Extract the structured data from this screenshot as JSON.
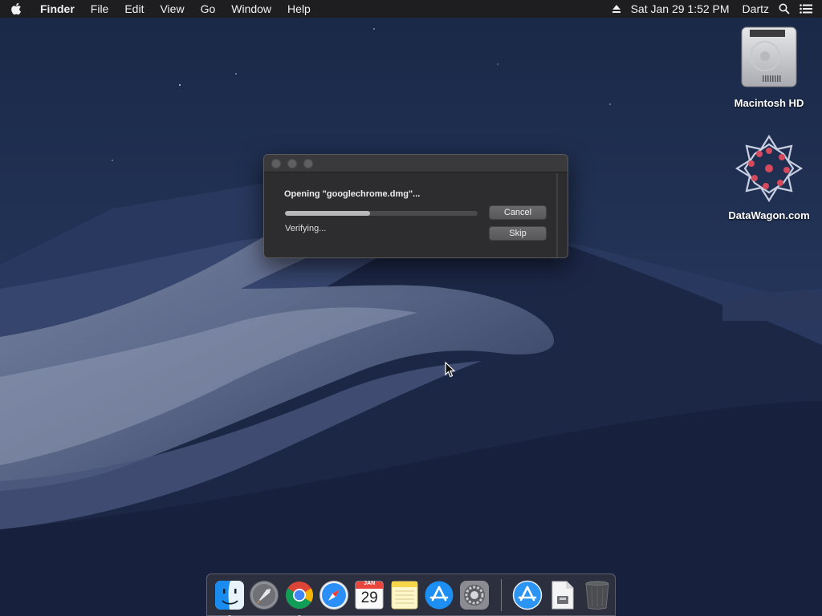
{
  "menubar": {
    "app_name": "Finder",
    "menus": [
      "File",
      "Edit",
      "View",
      "Go",
      "Window",
      "Help"
    ],
    "icons": [
      "apple-icon",
      "eject-icon",
      "spotlight-icon",
      "notification-center-icon"
    ],
    "clock": "Sat Jan 29  1:52 PM",
    "user": "Dartz"
  },
  "desktop": {
    "icons": [
      {
        "label": "Macintosh HD",
        "icon": "hard-drive-icon"
      },
      {
        "label": "DataWagon.com",
        "icon": "mounted-volume-icon"
      }
    ]
  },
  "dialog": {
    "title": "Opening \"googlechrome.dmg\"...",
    "status": "Verifying...",
    "progress": 0.44,
    "cancel_label": "Cancel",
    "skip_label": "Skip"
  },
  "dock": {
    "items": [
      {
        "name": "Finder",
        "icon": "finder-icon",
        "running": true
      },
      {
        "name": "Launchpad",
        "icon": "launchpad-icon",
        "running": false
      },
      {
        "name": "Google Chrome",
        "icon": "chrome-icon",
        "running": true
      },
      {
        "name": "Safari",
        "icon": "safari-icon",
        "running": false
      },
      {
        "name": "Calendar",
        "icon": "calendar-icon",
        "running": false,
        "month": "JAN",
        "day": "29"
      },
      {
        "name": "Notes",
        "icon": "notes-icon",
        "running": false
      },
      {
        "name": "App Store",
        "icon": "app-store-icon",
        "running": false
      },
      {
        "name": "System Preferences",
        "icon": "system-preferences-icon",
        "running": false
      },
      {
        "name": "Applications",
        "icon": "applications-folder-icon",
        "running": false
      },
      {
        "name": "Downloads",
        "icon": "downloads-icon",
        "running": false
      },
      {
        "name": "Trash",
        "icon": "trash-icon",
        "running": false
      }
    ]
  },
  "colors": {
    "menubar_bg": "#1e1e20",
    "dialog_bg": "#2d2d2f",
    "wallpaper_sky": "#1b2541",
    "accent_blue": "#1a8cf0"
  }
}
